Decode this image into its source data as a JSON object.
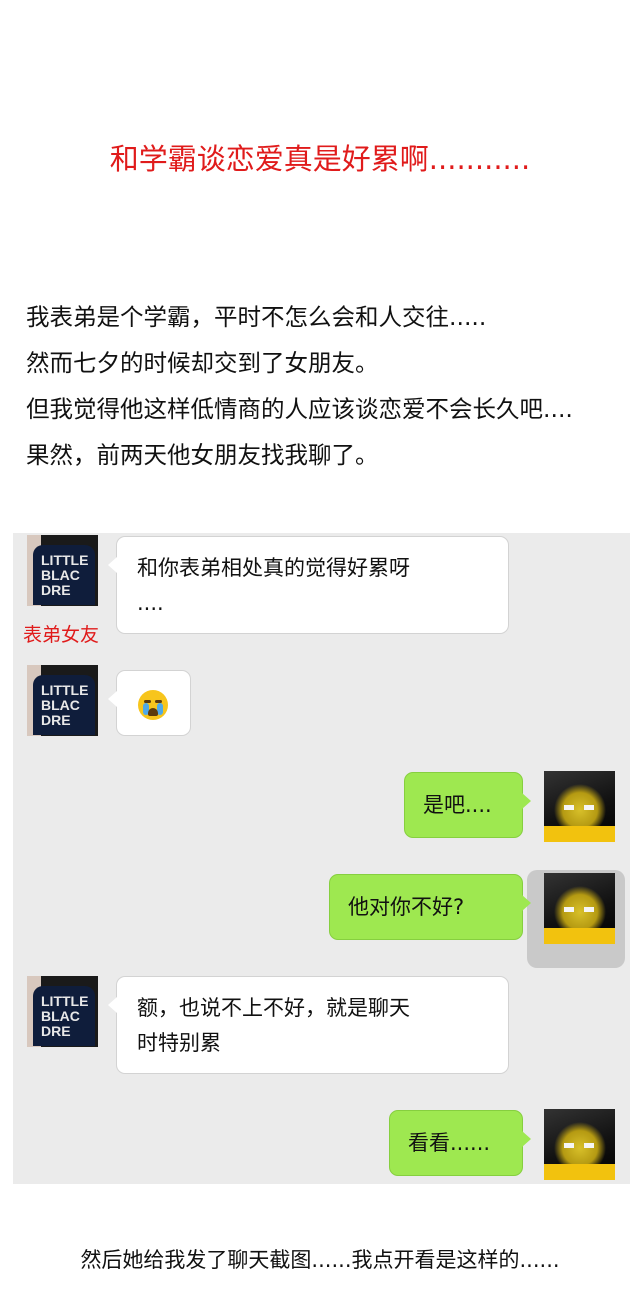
{
  "title": "和学霸谈恋爱真是好累啊...........",
  "intro_lines": [
    "我表弟是个学霸，平时不怎么会和人交往.....",
    "然而七夕的时候却交到了女朋友。",
    "但我觉得他这样低情商的人应该谈恋爱不会长久吧....",
    "果然，前两天他女朋友找我聊了。"
  ],
  "chat": {
    "nickname_label": "表弟女友",
    "avatar_her_text": "LITTLE BLAC DRE",
    "messages": [
      {
        "from": "her",
        "lines": [
          "和你表弟相处真的觉得好累呀",
          "...."
        ]
      },
      {
        "from": "her",
        "emoji": "crying-face"
      },
      {
        "from": "me",
        "text": "是吧...."
      },
      {
        "from": "me",
        "text": "他对你不好?"
      },
      {
        "from": "her",
        "lines": [
          "额，也说不上不好，就是聊天",
          "时特别累"
        ]
      },
      {
        "from": "me",
        "text": "看看......"
      }
    ]
  },
  "closing": "然后她给我发了聊天截图......我点开看是这样的......",
  "colors": {
    "title": "#e01b1b",
    "nickname": "#e01b1b",
    "my_bubble": "#9ee850",
    "chat_bg": "#ebebeb"
  }
}
